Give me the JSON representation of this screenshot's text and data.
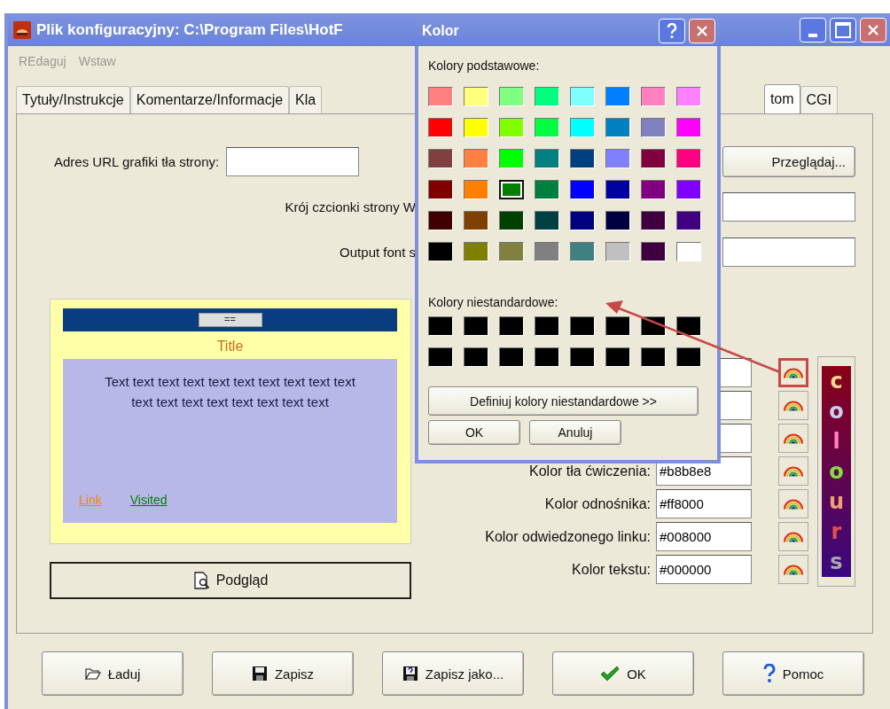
{
  "window": {
    "title": "Plik konfiguracyjny: C:\\Program Files\\HotF"
  },
  "menu": [
    "REdaguj",
    "Wstaw"
  ],
  "tabs": [
    {
      "label": "Tytuły/Instrukcje",
      "selected": false
    },
    {
      "label": "Komentarze/Informacje",
      "selected": false
    },
    {
      "label": "Kla",
      "selected": false
    },
    {
      "label": "tom",
      "selected": true
    },
    {
      "label": "CGI",
      "selected": false
    }
  ],
  "form": {
    "background_url_label": "Adres URL grafiki tła strony:",
    "browse_button": "Przeglądaj...",
    "font_label": "Krój czcionki strony W",
    "output_font_label": "Output font s"
  },
  "preview": {
    "window_button": "==",
    "title": "Title",
    "body": "Text text text text text text text text text text text text text text text text text text",
    "link": "Link",
    "visited": "Visited",
    "button": "Podgląd"
  },
  "color_rows": [
    {
      "highlighted": true
    },
    {
      "highlighted": false
    },
    {
      "highlighted": false
    },
    {
      "label": "Kolor tła ćwiczenia:",
      "value": "#b8b8e8",
      "highlighted": false
    },
    {
      "label": "Kolor odnośnika:",
      "value": "#ff8000",
      "highlighted": false
    },
    {
      "label": "Kolor odwiedzonego linku:",
      "value": "#008000",
      "highlighted": false
    },
    {
      "label": "Kolor tekstu:",
      "value": "#000000",
      "highlighted": false
    }
  ],
  "colours_logo": [
    {
      "char": "c",
      "color": "#f0d890"
    },
    {
      "char": "o",
      "color": "#c8d0f0"
    },
    {
      "char": "l",
      "color": "#ff80c0"
    },
    {
      "char": "o",
      "color": "#80e040"
    },
    {
      "char": "u",
      "color": "#f0a070"
    },
    {
      "char": "r",
      "color": "#e05050"
    },
    {
      "char": "s",
      "color": "#a8a8a8"
    }
  ],
  "buttons": [
    {
      "label": "Ładuj",
      "kind": "folder"
    },
    {
      "label": "Zapisz",
      "kind": "floppy"
    },
    {
      "label": "Zapisz jako...",
      "kind": "floppy-help"
    },
    {
      "label": "OK",
      "kind": "check"
    },
    {
      "label": "Pomoc",
      "kind": "help"
    }
  ],
  "color_dialog": {
    "title": "Kolor",
    "basic_label": "Kolory podstawowe:",
    "basic_colors": [
      {
        "color": "#ff8080",
        "selected": false
      },
      {
        "color": "#ffff80",
        "selected": false
      },
      {
        "color": "#80ff80",
        "selected": false
      },
      {
        "color": "#00ff80",
        "selected": false
      },
      {
        "color": "#80ffff",
        "selected": false
      },
      {
        "color": "#0080ff",
        "selected": false
      },
      {
        "color": "#ff80c0",
        "selected": false
      },
      {
        "color": "#ff80ff",
        "selected": false
      },
      {
        "color": "#ff0000",
        "selected": false
      },
      {
        "color": "#ffff00",
        "selected": false
      },
      {
        "color": "#80ff00",
        "selected": false
      },
      {
        "color": "#00ff40",
        "selected": false
      },
      {
        "color": "#00ffff",
        "selected": false
      },
      {
        "color": "#0080c0",
        "selected": false
      },
      {
        "color": "#8080c0",
        "selected": false
      },
      {
        "color": "#ff00ff",
        "selected": false
      },
      {
        "color": "#804040",
        "selected": false
      },
      {
        "color": "#ff8040",
        "selected": false
      },
      {
        "color": "#00ff00",
        "selected": false
      },
      {
        "color": "#008080",
        "selected": false
      },
      {
        "color": "#004080",
        "selected": false
      },
      {
        "color": "#8080ff",
        "selected": false
      },
      {
        "color": "#800040",
        "selected": false
      },
      {
        "color": "#ff0080",
        "selected": false
      },
      {
        "color": "#800000",
        "selected": false
      },
      {
        "color": "#ff8000",
        "selected": false
      },
      {
        "color": "#008000",
        "selected": true
      },
      {
        "color": "#008040",
        "selected": false
      },
      {
        "color": "#0000ff",
        "selected": false
      },
      {
        "color": "#0000a0",
        "selected": false
      },
      {
        "color": "#800080",
        "selected": false
      },
      {
        "color": "#8000ff",
        "selected": false
      },
      {
        "color": "#400000",
        "selected": false
      },
      {
        "color": "#804000",
        "selected": false
      },
      {
        "color": "#004000",
        "selected": false
      },
      {
        "color": "#004040",
        "selected": false
      },
      {
        "color": "#000080",
        "selected": false
      },
      {
        "color": "#000040",
        "selected": false
      },
      {
        "color": "#400040",
        "selected": false
      },
      {
        "color": "#400080",
        "selected": false
      },
      {
        "color": "#000000",
        "selected": false
      },
      {
        "color": "#808000",
        "selected": false
      },
      {
        "color": "#808040",
        "selected": false
      },
      {
        "color": "#808080",
        "selected": false
      },
      {
        "color": "#408080",
        "selected": false
      },
      {
        "color": "#c0c0c0",
        "selected": false
      },
      {
        "color": "#400040",
        "selected": false
      },
      {
        "color": "#ffffff",
        "selected": false
      }
    ],
    "custom_label": "Kolory niestandardowe:",
    "custom_colors": [
      {
        "color": "#000000"
      },
      {
        "color": "#000000"
      },
      {
        "color": "#000000"
      },
      {
        "color": "#000000"
      },
      {
        "color": "#000000"
      },
      {
        "color": "#000000"
      },
      {
        "color": "#000000"
      },
      {
        "color": "#000000"
      },
      {
        "color": "#000000"
      },
      {
        "color": "#000000"
      },
      {
        "color": "#000000"
      },
      {
        "color": "#000000"
      },
      {
        "color": "#000000"
      },
      {
        "color": "#000000"
      },
      {
        "color": "#000000"
      },
      {
        "color": "#000000"
      }
    ],
    "define_button": "Definiuj kolory niestandardowe >>",
    "ok_button": "OK",
    "cancel_button": "Anuluj"
  }
}
